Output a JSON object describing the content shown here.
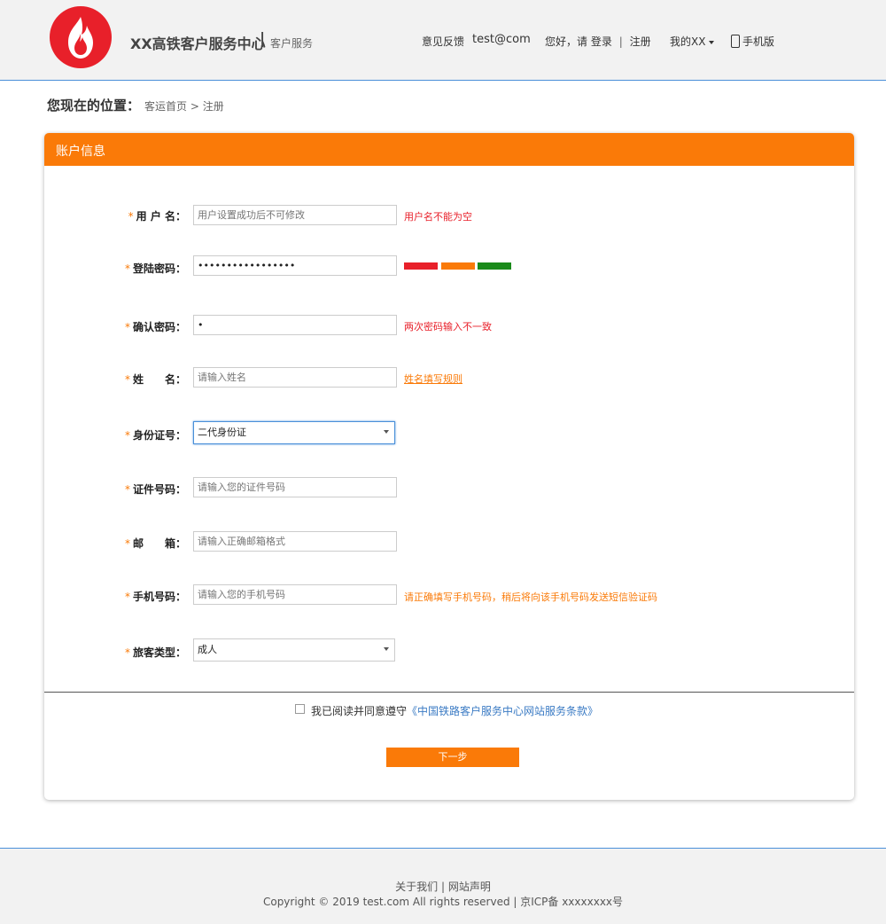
{
  "header": {
    "logo_icon": "flame-icon",
    "title": "XX高铁客户服务中心",
    "separator": "|",
    "subtitle": "客户服务",
    "feedback": "意见反馈",
    "email": "test@com",
    "greeting": "您好，请",
    "login": "登录",
    "nav_sep": "|",
    "register": "注册",
    "my_account": "我的XX",
    "mobile": "手机版"
  },
  "breadcrumb": {
    "label": "您现在的位置：",
    "home": "客运首页",
    "arrow": ">",
    "current": "注册"
  },
  "panel": {
    "title": "账户信息"
  },
  "form": {
    "username": {
      "label": "用 户 名：",
      "placeholder": "用户设置成功后不可修改",
      "message": "用户名不能为空"
    },
    "password": {
      "label": "登陆密码：",
      "value": "•••••••••••••••••"
    },
    "confirm": {
      "label": "确认密码：",
      "value": "•",
      "message": "两次密码输入不一致"
    },
    "name": {
      "label": "姓　　名：",
      "placeholder": "请输入姓名",
      "link": "姓名填写规则"
    },
    "id_type": {
      "label": "身份证号：",
      "selected": "二代身份证"
    },
    "id_number": {
      "label": "证件号码：",
      "placeholder": "请输入您的证件号码"
    },
    "email": {
      "label": "邮　　箱：",
      "placeholder": "请输入正确邮箱格式"
    },
    "phone": {
      "label": "手机号码：",
      "placeholder": "请输入您的手机号码",
      "message": "请正确填写手机号码，稍后将向该手机号码发送短信验证码"
    },
    "passenger_type": {
      "label": "旅客类型：",
      "selected": "成人"
    },
    "required_mark": "*"
  },
  "strength_colors": [
    "#e8202a",
    "#fa7a08",
    "#1a8a1a"
  ],
  "agreement": {
    "text": "我已阅读并同意遵守",
    "link": "《中国铁路客户服务中心网站服务条款》"
  },
  "next_button": "下一步",
  "footer": {
    "about": "关于我们",
    "sep": "|",
    "statement": "网站声明",
    "copyright": "Copyright © 2019 test.com All rights reserved | 京ICP备 xxxxxxxx号"
  }
}
